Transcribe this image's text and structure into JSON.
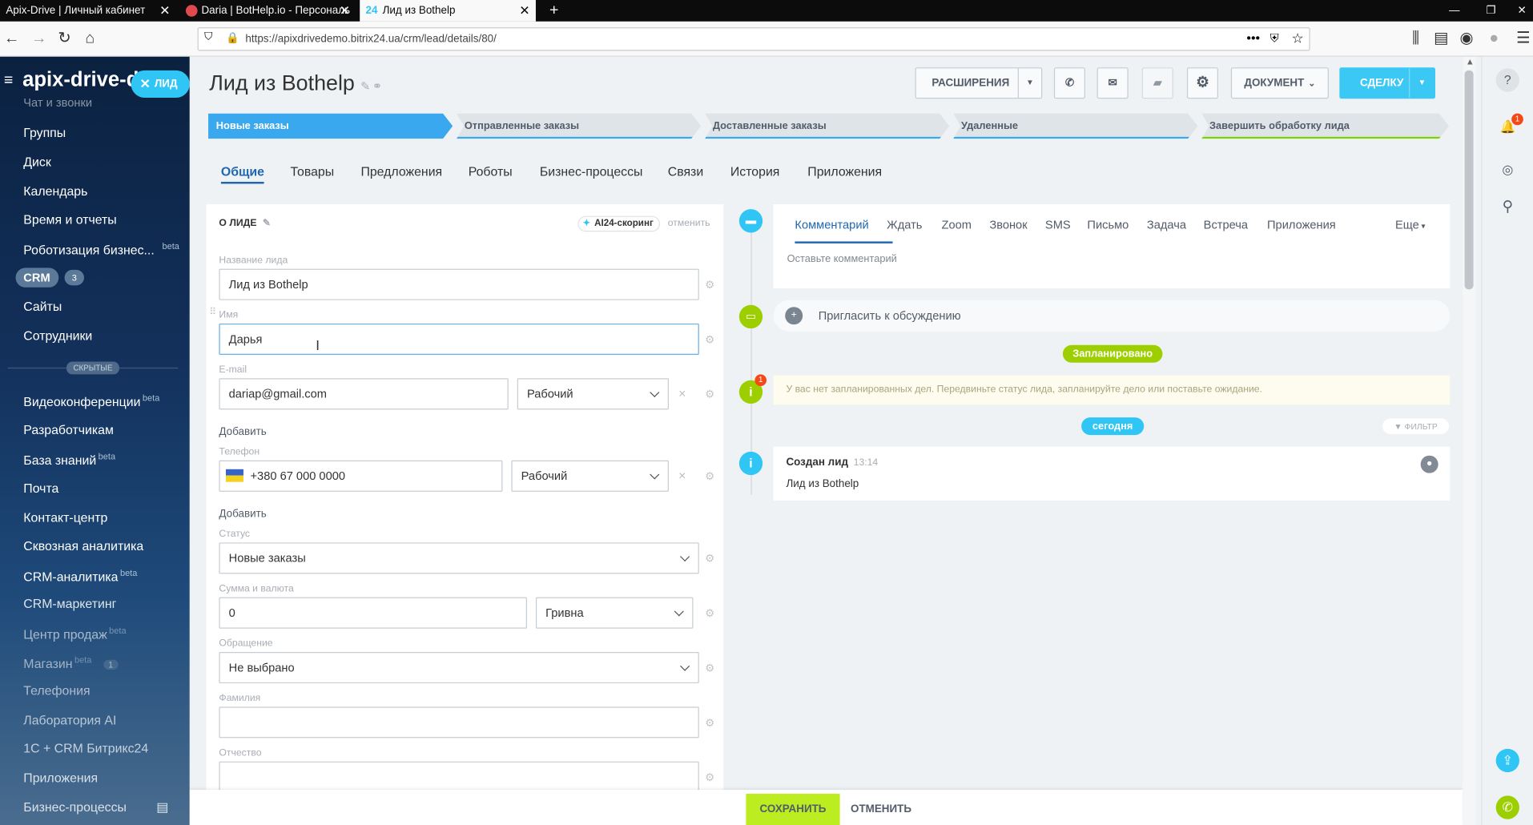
{
  "browser": {
    "tabs": [
      "Apix-Drive | Личный кабинет",
      "Daria | BotHelp.io - Персональ",
      "Лид из Bothelp"
    ],
    "tab3_icon": "24",
    "url": "https://apixdrivedemo.bitrix24.ua/crm/lead/details/80/"
  },
  "sidebar": {
    "brand": "apix-drive-d",
    "lead_chip": "ЛИД",
    "top_partial": "Чат и звонки",
    "items": [
      "Группы",
      "Диск",
      "Календарь",
      "Время и отчеты",
      "Роботизация бизнес..."
    ],
    "beta": "beta",
    "crm_label": "CRM",
    "crm_count": "3",
    "items2": [
      "Сайты",
      "Сотрудники"
    ],
    "hidden_label": "СКРЫТЫЕ",
    "items3": [
      "Видеоконференции",
      "Разработчикам",
      "База знаний",
      "Почта",
      "Контакт-центр",
      "Сквозная аналитика",
      "CRM-аналитика",
      "CRM-маркетинг",
      "Центр продаж",
      "Магазин",
      "Телефония",
      "Лаборатория AI",
      "1С + CRM Битрикс24",
      "Приложения",
      "Бизнес-процессы"
    ],
    "shop_count": "1"
  },
  "header": {
    "title": "Лид из  Bothelp",
    "extensions": "РАСШИРЕНИЯ",
    "document": "ДОКУМЕНТ",
    "deal": "СДЕЛКУ"
  },
  "stages": [
    "Новые заказы",
    "Отправленные заказы",
    "Доставленные заказы",
    "Удаленные",
    "Завершить обработку лида"
  ],
  "tabs": [
    "Общие",
    "Товары",
    "Предложения",
    "Роботы",
    "Бизнес-процессы",
    "Связи",
    "История",
    "Приложения"
  ],
  "form": {
    "section": "О ЛИДЕ",
    "ai": "AI24-скоринг",
    "cancel": "отменить",
    "name_label": "Название лида",
    "name_value": "Лид из Bothelp",
    "first_label": "Имя",
    "first_value": "Дарья",
    "email_label": "E-mail",
    "email_value": "dariap@gmail.com",
    "email_type": "Рабочий",
    "add1": "Добавить",
    "phone_label": "Телефон",
    "phone_value": "+380 67 000 0000",
    "phone_type": "Рабочий",
    "add2": "Добавить",
    "status_label": "Статус",
    "status_value": "Новые заказы",
    "sum_label": "Сумма и валюта",
    "sum_value": "0",
    "currency": "Гривна",
    "appeal_label": "Обращение",
    "appeal_value": "Не выбрано",
    "last_label": "Фамилия",
    "middle_label": "Отчество"
  },
  "timeline": {
    "tabs": [
      "Комментарий",
      "Ждать",
      "Zoom",
      "Звонок",
      "SMS",
      "Письмо",
      "Задача",
      "Встреча",
      "Приложения"
    ],
    "more": "Еще",
    "placeholder": "Оставьте комментарий",
    "invite": "Пригласить к обсуждению",
    "planned": "Запланировано",
    "empty": "У вас нет запланированных дел. Передвиньте статус лида, запланируйте дело или поставьте ожидание.",
    "today": "сегодня",
    "filter": "ФИЛЬТР",
    "created": "Создан лид",
    "time": "13:14",
    "created_name": "Лид из Bothelp",
    "badge": "1"
  },
  "footer": {
    "save": "СОХРАНИТЬ",
    "cancel": "ОТМЕНИТЬ"
  },
  "rightbar": {
    "notif": "1"
  }
}
